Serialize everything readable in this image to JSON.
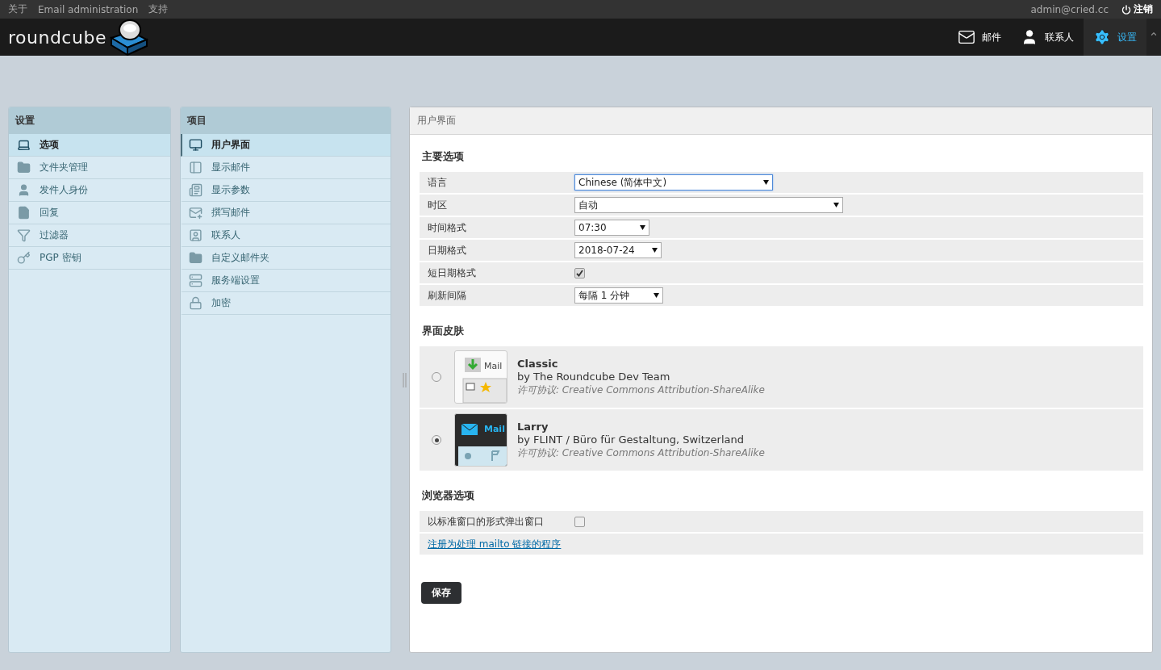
{
  "top_bar": {
    "links": [
      "关于",
      "Email administration",
      "支持"
    ],
    "user": "admin@cried.cc",
    "logout": "注销"
  },
  "header": {
    "logo": "roundcube",
    "nav": [
      {
        "label": "邮件",
        "selected": false
      },
      {
        "label": "联系人",
        "selected": false
      },
      {
        "label": "设置",
        "selected": true
      }
    ]
  },
  "settings_panel": {
    "title": "设置",
    "items": [
      {
        "label": "选项",
        "selected": true
      },
      {
        "label": "文件夹管理",
        "selected": false
      },
      {
        "label": "发件人身份",
        "selected": false
      },
      {
        "label": "回复",
        "selected": false
      },
      {
        "label": "过滤器",
        "selected": false
      },
      {
        "label": "PGP 密钥",
        "selected": false
      }
    ]
  },
  "sections_panel": {
    "title": "项目",
    "items": [
      {
        "label": "用户界面",
        "selected": true
      },
      {
        "label": "显示邮件",
        "selected": false
      },
      {
        "label": "显示参数",
        "selected": false
      },
      {
        "label": "撰写邮件",
        "selected": false
      },
      {
        "label": "联系人",
        "selected": false
      },
      {
        "label": "自定义邮件夹",
        "selected": false
      },
      {
        "label": "服务端设置",
        "selected": false
      },
      {
        "label": "加密",
        "selected": false
      }
    ]
  },
  "main": {
    "title": "用户界面",
    "main_options": {
      "title": "主要选项",
      "rows": [
        {
          "kind": "select",
          "label": "语言",
          "value": "Chinese (简体中文)",
          "focused": true
        },
        {
          "kind": "select",
          "label": "时区",
          "value": "自动",
          "focused": false
        },
        {
          "kind": "select",
          "label": "时间格式",
          "value": "07:30",
          "focused": false
        },
        {
          "kind": "select",
          "label": "日期格式",
          "value": "2018-07-24",
          "focused": false
        },
        {
          "kind": "checkbox",
          "label": "短日期格式",
          "checked": true
        },
        {
          "kind": "select",
          "label": "刷新间隔",
          "value": "每隔 1 分钟",
          "focused": false
        }
      ]
    },
    "skins": {
      "title": "界面皮肤",
      "items": [
        {
          "kind": "classic",
          "name": "Classic",
          "author": "by The Roundcube Dev Team",
          "license": "许可协议: Creative Commons Attribution-ShareAlike",
          "thumb_label": "Mail",
          "selected": false
        },
        {
          "kind": "larry",
          "name": "Larry",
          "author": "by FLINT / Büro für Gestaltung, Switzerland",
          "license": "许可协议: Creative Commons Attribution-ShareAlike",
          "thumb_label": "Mail",
          "selected": true
        }
      ]
    },
    "browser_options": {
      "title": "浏览器选项",
      "rows": [
        {
          "kind": "checkbox",
          "label": "以标准窗口的形式弹出窗口",
          "checked": false
        },
        {
          "kind": "link",
          "label": "注册为处理 mailto 链接的程序"
        }
      ]
    },
    "save_button": "保存"
  }
}
